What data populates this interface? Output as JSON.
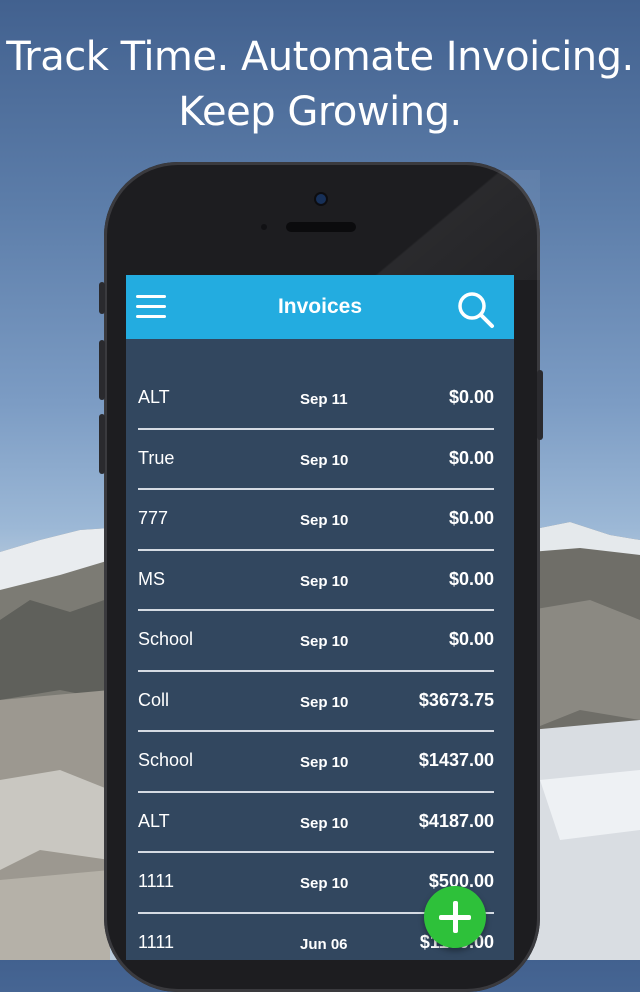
{
  "promo": {
    "line1": "Track Time. Automate Invoicing.",
    "line2": "Keep Growing."
  },
  "appbar": {
    "title": "Invoices",
    "menu_icon": "hamburger-menu-icon",
    "search_icon": "search-icon",
    "color": "#23ace0"
  },
  "invoices": [
    {
      "name": "ALT",
      "date": "Sep 11",
      "amount": "$0.00"
    },
    {
      "name": "True",
      "date": "Sep 10",
      "amount": "$0.00"
    },
    {
      "name": "777",
      "date": "Sep 10",
      "amount": "$0.00"
    },
    {
      "name": "MS",
      "date": "Sep 10",
      "amount": "$0.00"
    },
    {
      "name": "School",
      "date": "Sep 10",
      "amount": "$0.00"
    },
    {
      "name": "Coll",
      "date": "Sep 10",
      "amount": "$3673.75"
    },
    {
      "name": "School",
      "date": "Sep 10",
      "amount": "$1437.00"
    },
    {
      "name": "ALT",
      "date": "Sep 10",
      "amount": "$4187.00"
    },
    {
      "name": "1111",
      "date": "Sep 10",
      "amount": "$500.00"
    },
    {
      "name": "1111",
      "date": "Jun 06",
      "amount": "$1100.00"
    }
  ],
  "fab": {
    "icon": "plus-icon",
    "color": "#2ec13a"
  },
  "colors": {
    "list_background": "#32475f",
    "text": "#ffffff"
  }
}
